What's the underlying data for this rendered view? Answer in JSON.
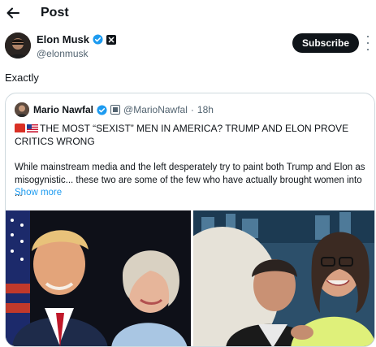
{
  "header": {
    "title": "Post",
    "back_icon": "arrow-left-icon"
  },
  "author": {
    "name": "Elon Musk",
    "handle": "@elonmusk",
    "verified": true,
    "badge": "x-affiliate-badge",
    "subscribe_label": "Subscribe"
  },
  "tweet": {
    "text": "Exactly"
  },
  "quote": {
    "name": "Mario Nawfal",
    "handle": "@MarioNawfal",
    "time": "18h",
    "headline": "THE MOST “SEXIST” MEN IN AMERICA? TRUMP AND ELON PROVE CRITICS WRONG",
    "body": "While mainstream media and the left desperately try to paint both Trump and Elon as misogynistic... these two are some of the few who have actually brought women into ...",
    "show_more": "Show more"
  },
  "colors": {
    "accent": "#1d9bf0",
    "text": "#0f1419",
    "muted": "#536471",
    "border": "#cfd9de"
  }
}
